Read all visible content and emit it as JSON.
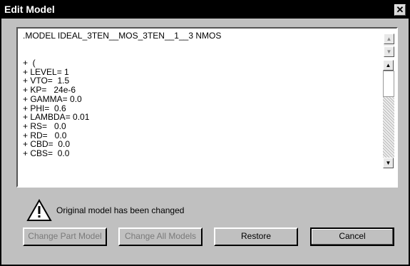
{
  "window": {
    "title": "Edit Model",
    "close_glyph": "✕"
  },
  "model_text": {
    "header": ".MODEL IDEAL_3TEN__MOS_3TEN__1__3 NMOS",
    "lines": [
      "+  (",
      "+ LEVEL= 1",
      "+ VTO=  1.5",
      "+ KP=   24e-6",
      "+ GAMMA= 0.0",
      "+ PHI=  0.6",
      "+ LAMBDA= 0.01",
      "+ RS=   0.0",
      "+ RD=   0.0",
      "+ CBD=  0.0",
      "+ CBS=  0.0"
    ]
  },
  "status": {
    "message": "Original model has been changed",
    "icon": "warning-icon"
  },
  "buttons": {
    "change_part": "Change Part Model",
    "change_all": "Change All Models",
    "restore": "Restore",
    "cancel": "Cancel"
  }
}
